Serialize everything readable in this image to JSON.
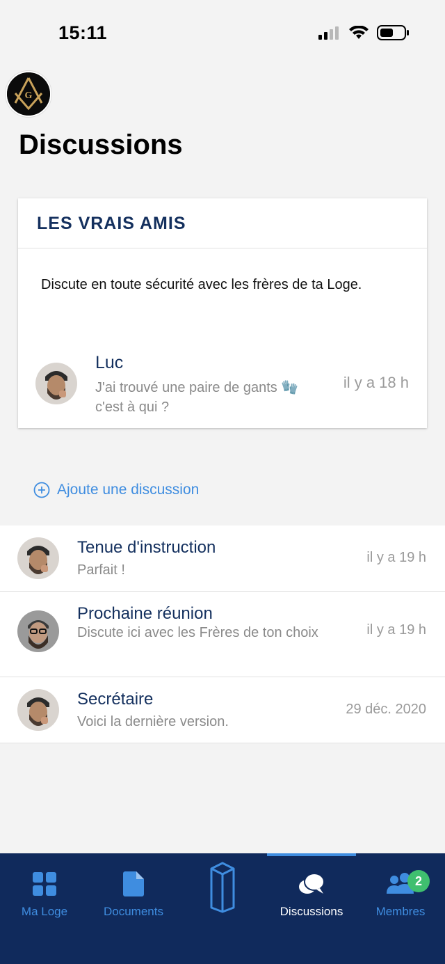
{
  "status_bar": {
    "time": "15:11"
  },
  "header": {
    "title": "Discussions"
  },
  "featured": {
    "title": "LES VRAIS AMIS",
    "description": "Discute en toute sécurité avec les frères de ta Loge.",
    "last_message": {
      "sender": "Luc",
      "preview": "J'ai trouvé une paire de gants 🧤 c'est à qui ?",
      "time": "il y a 18 h"
    }
  },
  "add_discussion": {
    "label": "Ajoute une discussion"
  },
  "discussions": [
    {
      "title": "Tenue d'instruction",
      "preview": "Parfait !",
      "time": "il y a 19 h"
    },
    {
      "title": "Prochaine réunion",
      "preview": "Discute ici avec les Frères de ton choix",
      "time": "il y a 19 h"
    },
    {
      "title": "Secrétaire",
      "preview": "Voici la dernière version.",
      "time": "29 déc. 2020"
    }
  ],
  "tabbar": {
    "tabs": [
      {
        "label": "Ma Loge",
        "icon": "grid-icon"
      },
      {
        "label": "Documents",
        "icon": "document-icon"
      },
      {
        "label": "",
        "icon": "pillar-icon"
      },
      {
        "label": "Discussions",
        "icon": "chat-bubbles-icon",
        "active": true
      },
      {
        "label": "Membres",
        "icon": "users-icon",
        "badge": "2"
      }
    ]
  },
  "colors": {
    "navy": "#102a5c",
    "accent": "#3f8de0",
    "title_blue": "#14305e",
    "badge_green": "#3fbf6f"
  }
}
